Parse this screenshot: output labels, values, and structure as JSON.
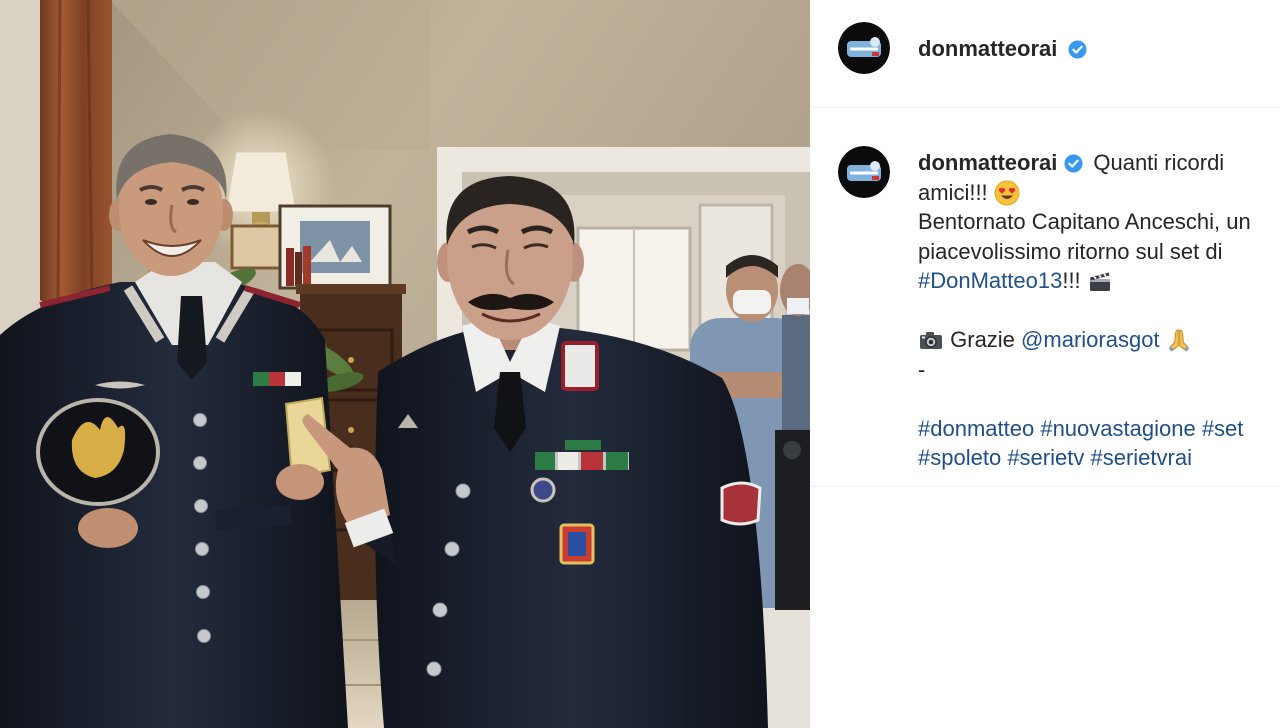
{
  "header": {
    "username": "donmatteorai",
    "avatar_icon": "don-matteo-logo-icon",
    "verified_icon": "verified-badge-icon"
  },
  "caption": {
    "username": "donmatteorai",
    "intro": "Quanti ricordi",
    "intro_cont": "amici!!!",
    "intro_emoji": "heart-eyes-emoji-icon",
    "body_line1": "Bentornato Capitano Anceschi, un",
    "body_line2": "piacevolissimo ritorno sul set di",
    "season_hashtag": "#DonMatteo13",
    "season_suffix": "!!!",
    "season_emoji": "clapper-board-emoji-icon",
    "credit_emoji": "camera-emoji-icon",
    "credit_text": "Grazie",
    "credit_mention": "@mariorasgot",
    "credit_end_emoji": "folded-hands-emoji-icon",
    "separator": "-",
    "hashtag_rows": [
      [
        "#donmatteo",
        "#nuovastagione",
        "#set"
      ],
      [
        "#spoleto",
        "#serietv",
        "#serietvrai"
      ]
    ]
  },
  "colors": {
    "text": "#262626",
    "link": "#1f4f8b",
    "verified": "#3897f0",
    "divider": "#efefef",
    "panel_background": "#ffffff"
  }
}
